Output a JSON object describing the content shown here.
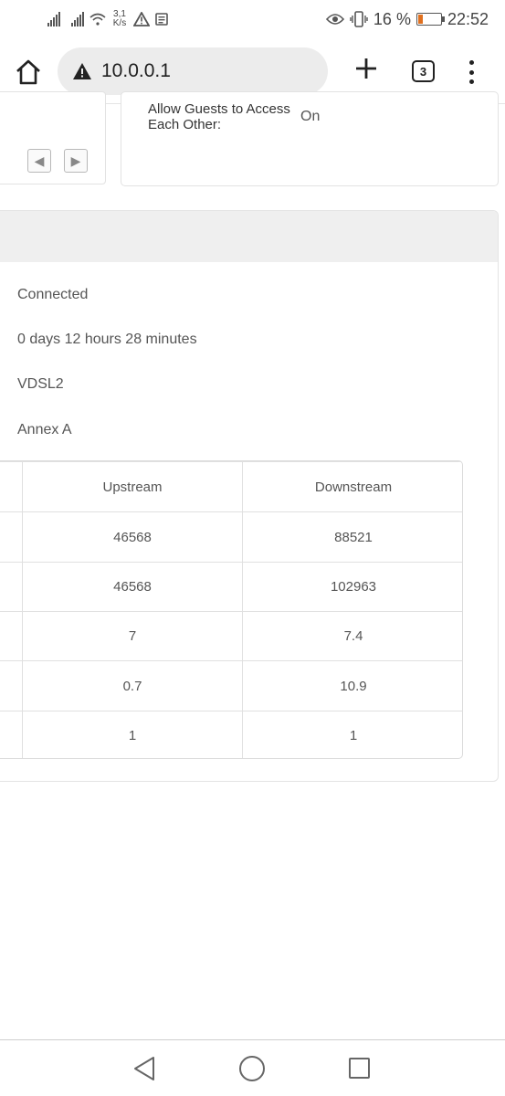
{
  "status_bar": {
    "net_speed_value": "3,1",
    "net_speed_unit": "K/s",
    "battery_percent": "16 %",
    "time": "22:52"
  },
  "browser": {
    "url": "10.0.0.1",
    "tab_count": "3"
  },
  "guest_settings": {
    "label": "Allow Guests to Access Each Other:",
    "value": "On"
  },
  "dsl_info": {
    "status": "Connected",
    "uptime": "0 days 12 hours 28 minutes",
    "mode": "VDSL2",
    "annex": "Annex A"
  },
  "stats_table": {
    "columns": [
      "Upstream",
      "Downstream"
    ],
    "rows": [
      [
        "46568",
        "88521"
      ],
      [
        "46568",
        "102963"
      ],
      [
        "7",
        "7.4"
      ],
      [
        "0.7",
        "10.9"
      ],
      [
        "1",
        "1"
      ]
    ]
  }
}
